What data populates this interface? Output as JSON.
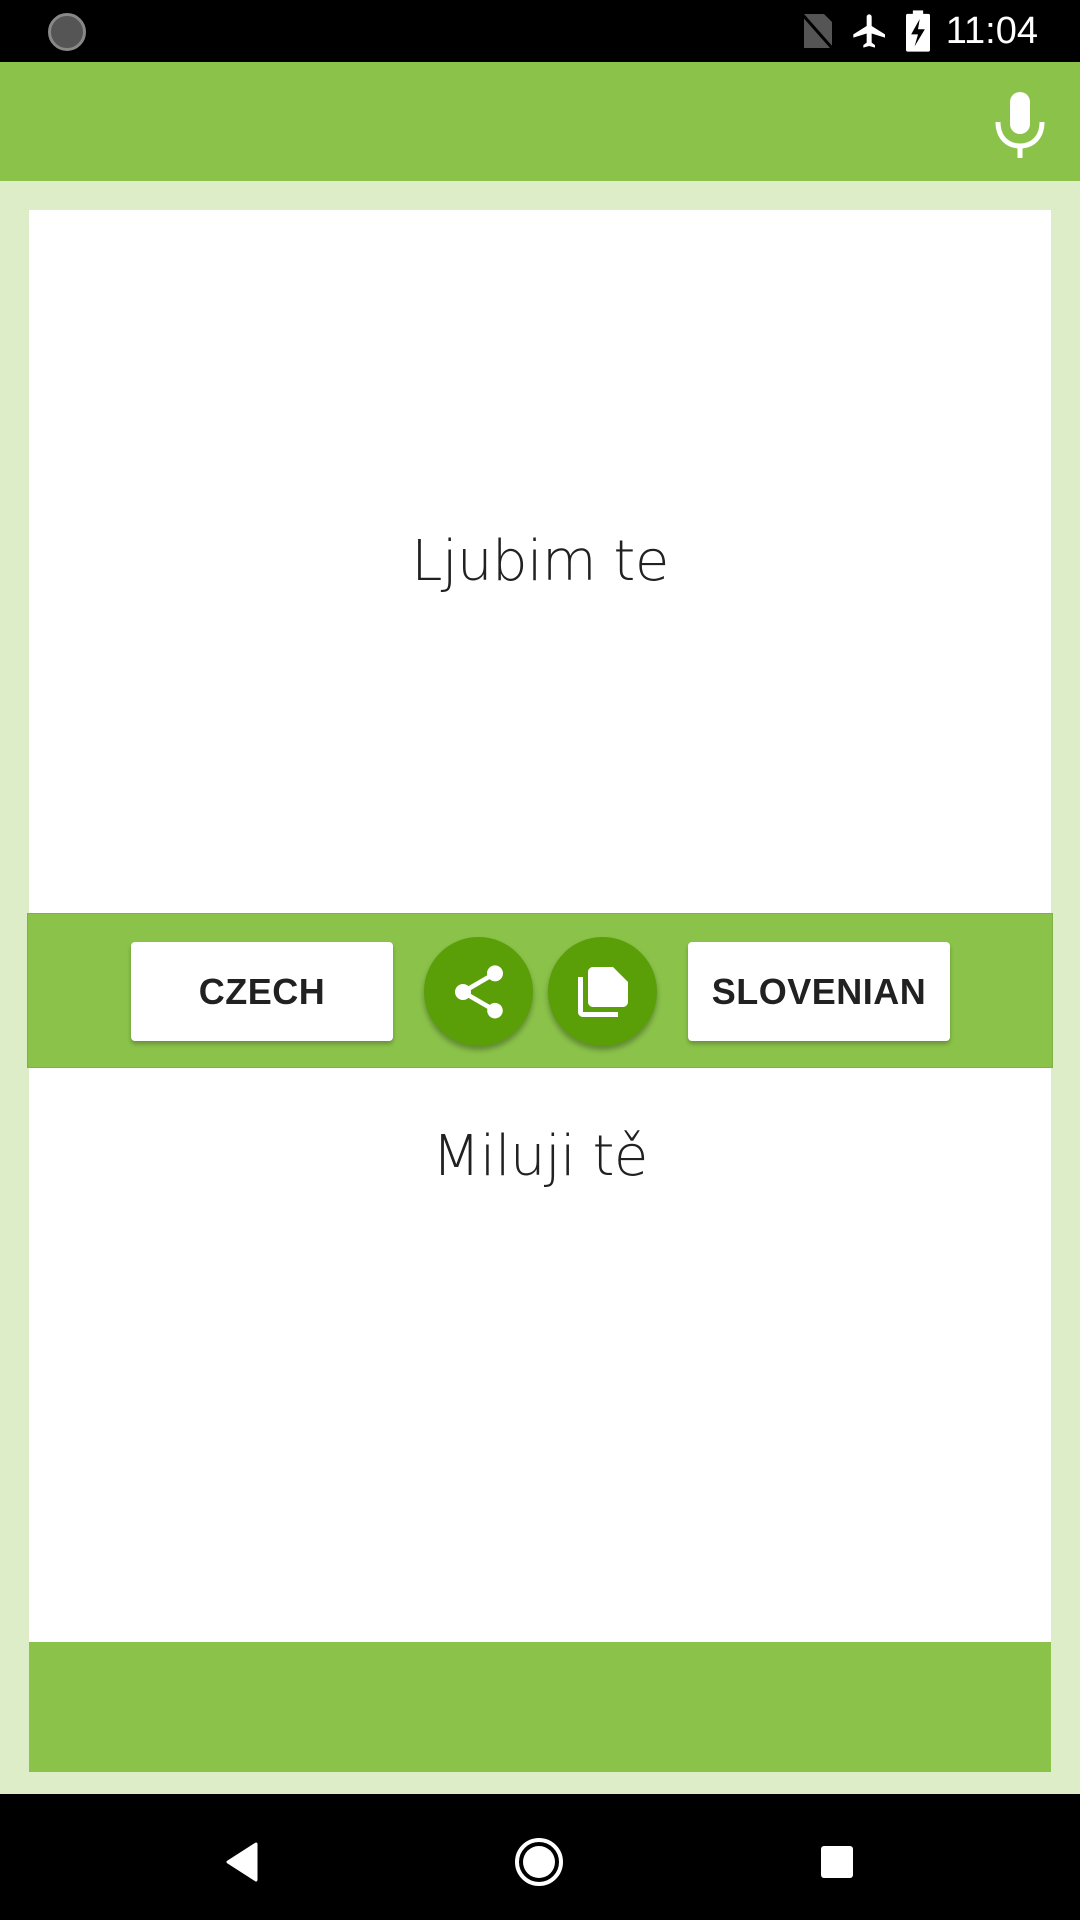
{
  "status_bar": {
    "time": "11:04",
    "icons": [
      "sync-icon",
      "no-sim-icon",
      "airplane-mode-icon",
      "battery-charging-icon"
    ]
  },
  "app_bar": {
    "actions": [
      {
        "icon": "microphone-icon",
        "label": "Voice input"
      }
    ]
  },
  "source": {
    "text": "Ljubim te",
    "language": "SLOVENIAN"
  },
  "translation": {
    "text": "Miluji tě",
    "language": "CZECH"
  },
  "middle_bar": {
    "left_language_label": "CZECH",
    "right_language_label": "SLOVENIAN",
    "share_icon": "share-icon",
    "copy_icon": "copy-icon"
  },
  "nav_bar": {
    "buttons": [
      "back",
      "home",
      "recents"
    ]
  },
  "colors": {
    "primary": "#8bc34a",
    "accent": "#5a9e08",
    "background": "#dcedc8"
  }
}
